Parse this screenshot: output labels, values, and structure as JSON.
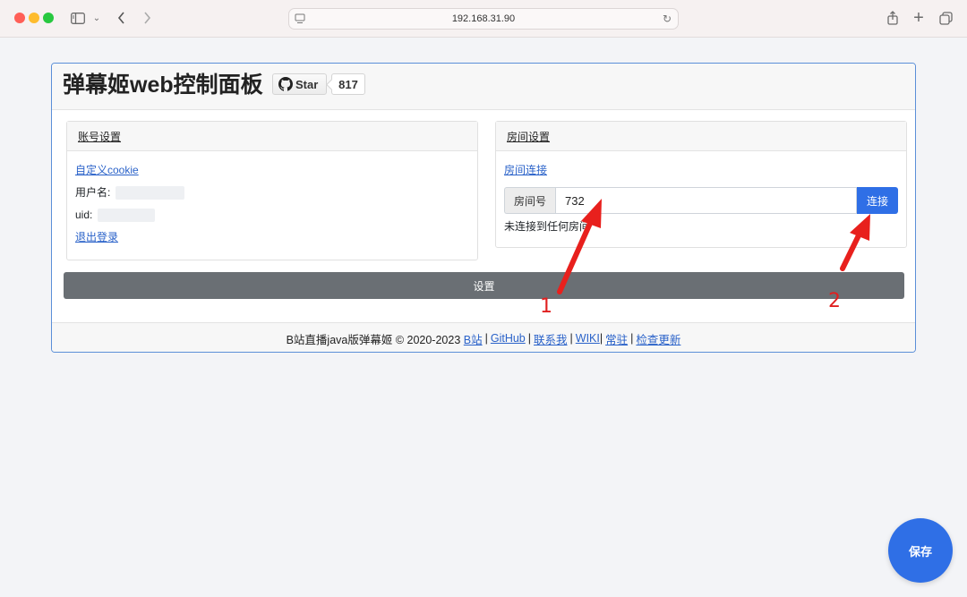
{
  "browser": {
    "url": "192.168.31.90",
    "icons": [
      "sidebar-icon",
      "chevron-down-icon",
      "back-icon",
      "forward-icon",
      "reader-icon",
      "reload-icon",
      "share-icon",
      "plus-icon",
      "tabs-icon"
    ]
  },
  "header": {
    "title": "弹幕姬web控制面板",
    "star_label": "Star",
    "star_count": "817"
  },
  "account": {
    "title": "账号设置",
    "custom_cookie": "自定义cookie",
    "username_label": "用户名:",
    "uid_label": "uid:",
    "logout": "退出登录"
  },
  "room": {
    "title": "房间设置",
    "connect_link": "房间连接",
    "room_label": "房间号",
    "room_value": "732",
    "connect_button": "连接",
    "status": "未连接到任何房间"
  },
  "set_button": "设置",
  "footer": {
    "prefix": "B站直播java版弹幕姬 © 2020-2023",
    "links": [
      "B站",
      "GitHub",
      "联系我",
      "WIKI",
      "常驻",
      "检查更新"
    ]
  },
  "save_button": "保存",
  "annotations": {
    "label_1": "1",
    "label_2": "2",
    "color": "#e02020"
  },
  "colors": {
    "primary": "#2f6fe6",
    "secondary": "#6a6f74",
    "link": "#2a62c9",
    "panel_border": "#5b8fd8"
  }
}
